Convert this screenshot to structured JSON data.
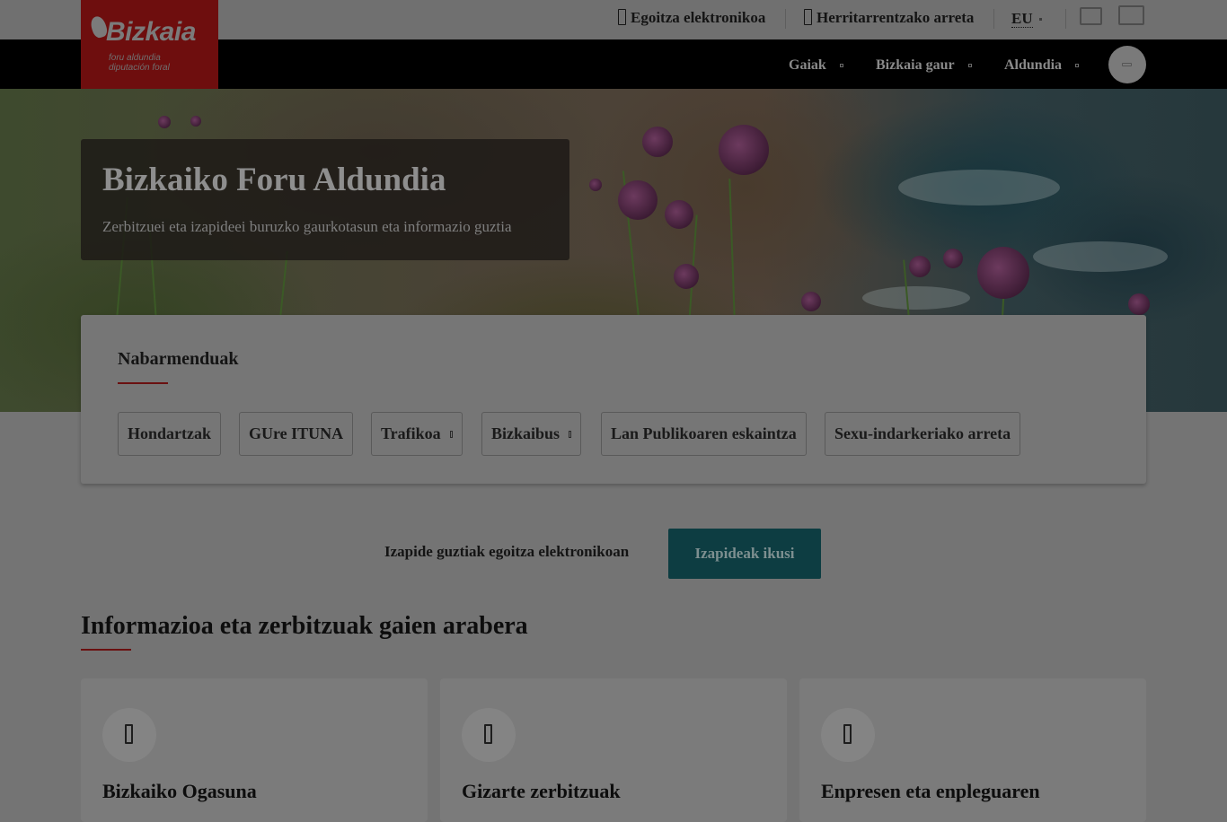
{
  "header": {
    "links": [
      {
        "label": "Egoitza elektronikoa",
        "icon": "external-link-icon"
      },
      {
        "label": "Herritarrentzako arreta",
        "icon": "phone-icon"
      }
    ],
    "language": "EU",
    "utility_icons": [
      "fit-screen-icon",
      "add-window-icon"
    ]
  },
  "logo": {
    "word": "Bizkaia",
    "line1": "foru aldundia",
    "line2": "diputación foral"
  },
  "nav": {
    "items": [
      {
        "label": "Gaiak"
      },
      {
        "label": "Bizkaia gaur"
      },
      {
        "label": "Aldundia"
      }
    ],
    "search_icon": "search-icon"
  },
  "hero": {
    "title": "Bizkaiko Foru Aldundia",
    "subtitle": "Zerbitzuei eta izapideei buruzko gaurkotasun eta informazio guztia"
  },
  "highlights": {
    "title": "Nabarmenduak",
    "chips": [
      {
        "label": "Hondartzak",
        "dropdown": false
      },
      {
        "label": "GUre ITUNA",
        "dropdown": false
      },
      {
        "label": "Trafikoa",
        "dropdown": true
      },
      {
        "label": "Bizkaibus",
        "dropdown": true
      },
      {
        "label": "Lan Publikoaren eskaintza",
        "dropdown": false
      },
      {
        "label": "Sexu-indarkeriako arreta",
        "dropdown": false
      }
    ]
  },
  "procedures": {
    "text": "Izapide guztiak egoitza elektronikoan",
    "button": "Izapideak ikusi"
  },
  "topics": {
    "title": "Informazioa eta zerbitzuak gaien arabera",
    "cards": [
      {
        "title": "Bizkaiko Ogasuna",
        "icon": "treasury-icon"
      },
      {
        "title": "Gizarte zerbitzuak",
        "icon": "social-services-icon"
      },
      {
        "title": "Enpresen eta enpleguaren",
        "icon": "business-icon"
      }
    ]
  },
  "colors": {
    "overlay": "#747474",
    "brand_red": "#6e0e0e",
    "nav_bg": "#000000",
    "button_bg": "#0d3d42"
  }
}
